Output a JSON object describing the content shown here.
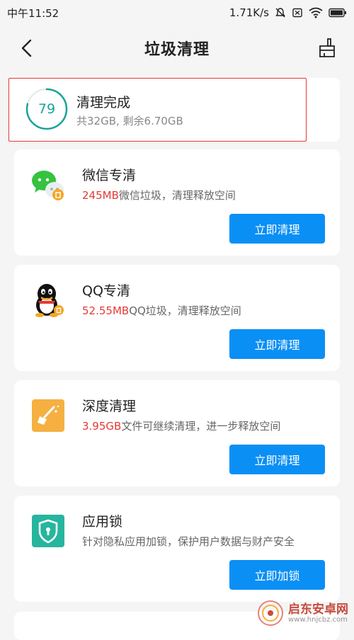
{
  "status_bar": {
    "time": "中午11:52",
    "network_speed": "1.71K/s",
    "icons": [
      "mute-icon",
      "sim-icon",
      "wifi-icon",
      "battery-icon"
    ]
  },
  "nav": {
    "title": "垃圾清理",
    "back_icon": "chevron-left-icon",
    "action_icon": "broom-icon"
  },
  "summary": {
    "score": "79",
    "title": "清理完成",
    "storage_text": "共32GB, 剩余6.70GB",
    "ring_color": "#1aa39a",
    "highlight_color": "#e53935"
  },
  "cards": [
    {
      "id": "wechat",
      "icon": "wechat-icon",
      "title": "微信专清",
      "highlight": "245MB",
      "desc": "微信垃圾，清理释放空间",
      "button": "立即清理"
    },
    {
      "id": "qq",
      "icon": "qq-icon",
      "title": "QQ专清",
      "highlight": "52.55MB",
      "desc": "QQ垃圾，清理释放空间",
      "button": "立即清理"
    },
    {
      "id": "deep",
      "icon": "deep-clean-icon",
      "title": "深度清理",
      "highlight": "3.95GB",
      "desc": "文件可继续清理，进一步释放空间",
      "button": "立即清理"
    },
    {
      "id": "applock",
      "icon": "app-lock-icon",
      "title": "应用锁",
      "highlight": "",
      "desc": "针对隐私应用加锁，保护用户数据与财产安全",
      "button": "立即加锁"
    }
  ],
  "colors": {
    "accent_button": "#0a8ff5",
    "highlight_text": "#e53935"
  },
  "watermark": {
    "brand": "启东安卓网",
    "url": "www.hnjcbz.com"
  }
}
